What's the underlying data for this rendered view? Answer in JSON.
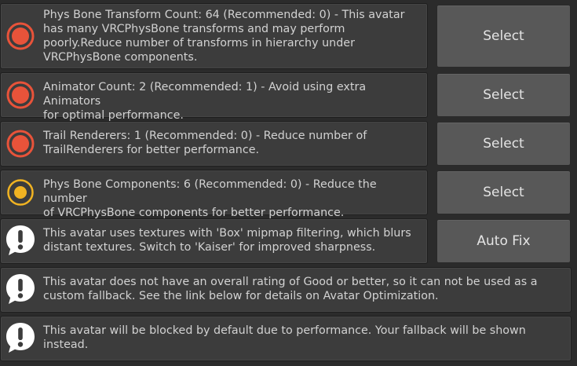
{
  "colors": {
    "background": "#2b2b2b",
    "card": "#3c3c3c",
    "button": "#585858",
    "error": "#e8533a",
    "warning": "#f0b322",
    "info": "#ffffff"
  },
  "messages": [
    {
      "severity": "error",
      "icon": "error-icon",
      "text": "Phys Bone Transform Count: 64 (Recommended: 0) - This avatar\nhas many VRCPhysBone transforms and may perform\npoorly.Reduce number of transforms in hierarchy under\nVRCPhysBone components.",
      "button": "Select"
    },
    {
      "severity": "error",
      "icon": "error-icon",
      "text": "Animator Count: 2 (Recommended: 1) - Avoid using extra Animators\nfor optimal performance.",
      "button": "Select"
    },
    {
      "severity": "error",
      "icon": "error-icon",
      "text": "Trail Renderers: 1 (Recommended: 0) - Reduce number of\nTrailRenderers for better performance.",
      "button": "Select"
    },
    {
      "severity": "warning",
      "icon": "warning-icon",
      "text": "Phys Bone Components: 6 (Recommended: 0) - Reduce the number\nof VRCPhysBone components for better performance.",
      "button": "Select"
    },
    {
      "severity": "info",
      "icon": "info-bubble-icon",
      "text": "This avatar uses textures with 'Box' mipmap filtering, which blurs\ndistant textures. Switch to 'Kaiser' for improved sharpness.",
      "button": "Auto Fix"
    },
    {
      "severity": "info",
      "icon": "info-bubble-icon",
      "text": "This avatar does not have an overall rating of Good or better, so it can not be used as a\ncustom fallback. See the link below for details on Avatar Optimization."
    },
    {
      "severity": "info",
      "icon": "info-bubble-icon",
      "text": "This avatar will be blocked by default due to performance. Your fallback will be shown\ninstead."
    }
  ]
}
